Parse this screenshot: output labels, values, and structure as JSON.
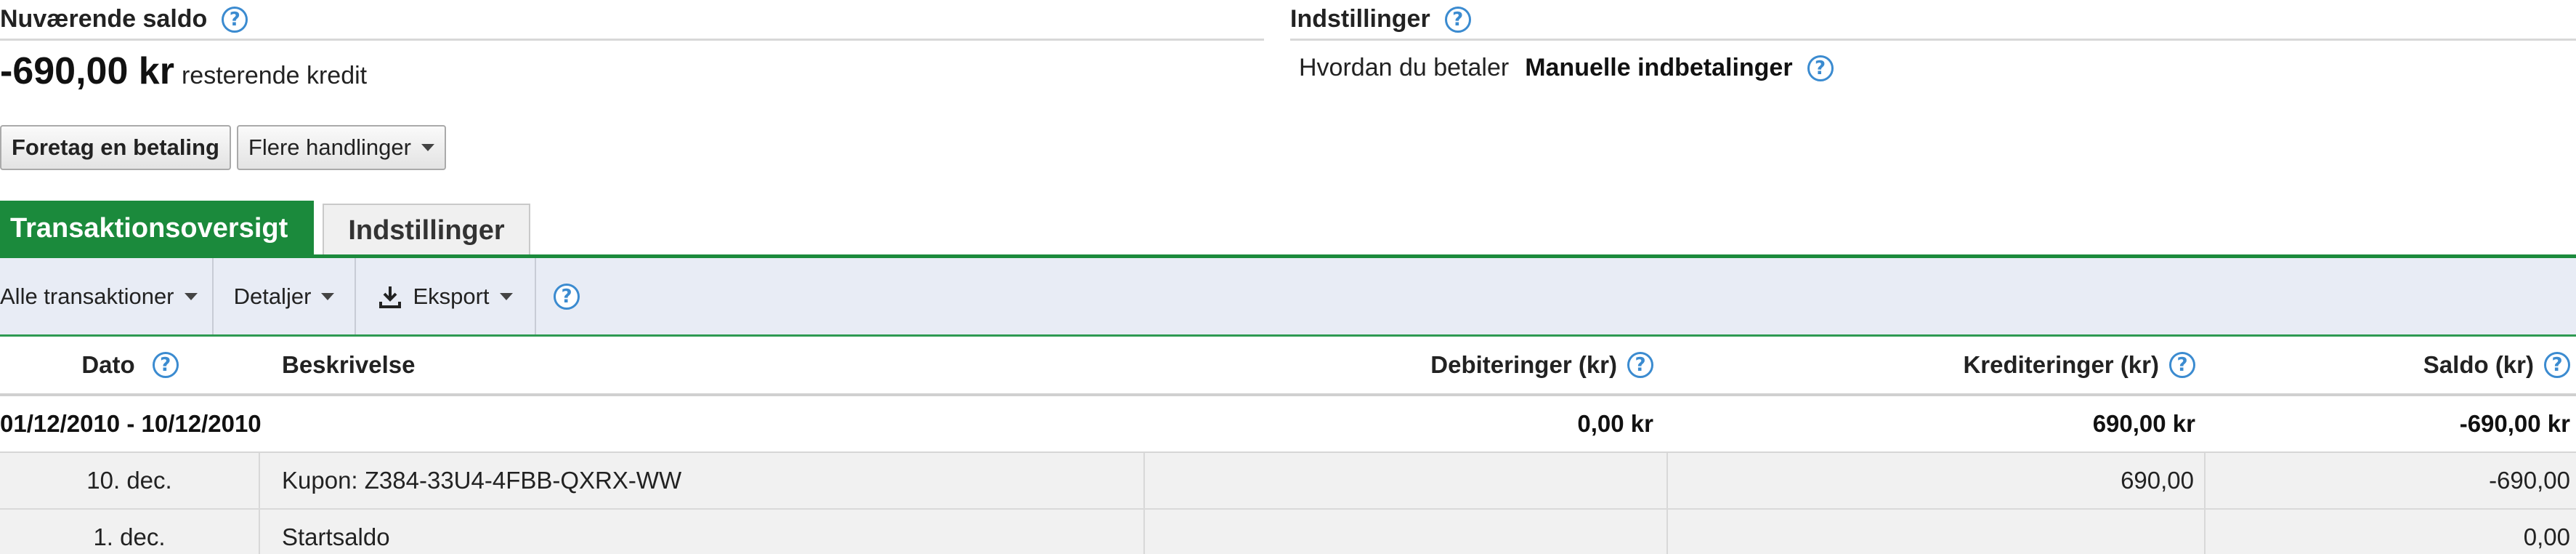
{
  "summary": {
    "title": "Nuværende saldo",
    "help": "?",
    "balance": "-690,00 kr",
    "balance_note": "resterende kredit"
  },
  "settings": {
    "title": "Indstillinger",
    "help": "?",
    "payment_label": "Hvordan du betaler",
    "payment_value": "Manuelle indbetalinger"
  },
  "actions": {
    "pay_label": "Foretag en betaling",
    "more_label": "Flere handlinger"
  },
  "tabs": {
    "active": "Transaktionsoversigt",
    "inactive": "Indstillinger"
  },
  "toolbar": {
    "filter_label": "Alle transaktioner",
    "details_label": "Detaljer",
    "export_label": "Eksport",
    "help": "?"
  },
  "table": {
    "headers": {
      "date": "Dato",
      "description": "Beskrivelse",
      "debits": "Debiteringer (kr)",
      "credits": "Krediteringer (kr)",
      "balance": "Saldo (kr)"
    },
    "group": {
      "period": "01/12/2010 - 10/12/2010",
      "debits": "0,00 kr",
      "credits": "690,00 kr",
      "balance": "-690,00 kr"
    },
    "rows": [
      {
        "date": "10. dec.",
        "description": "Kupon: Z384-33U4-4FBB-QXRX-WW",
        "debit": "",
        "credit": "690,00",
        "balance": "-690,00"
      },
      {
        "date": "1. dec.",
        "description": "Startsaldo",
        "debit": "",
        "credit": "",
        "balance": "0,00"
      }
    ]
  },
  "colors": {
    "accent_green": "#1b8a3c",
    "toolbar_bg": "#e8ecf5",
    "help_blue": "#3b8bd0"
  },
  "icons": [
    "help-icon",
    "caret-down-icon",
    "download-icon"
  ]
}
